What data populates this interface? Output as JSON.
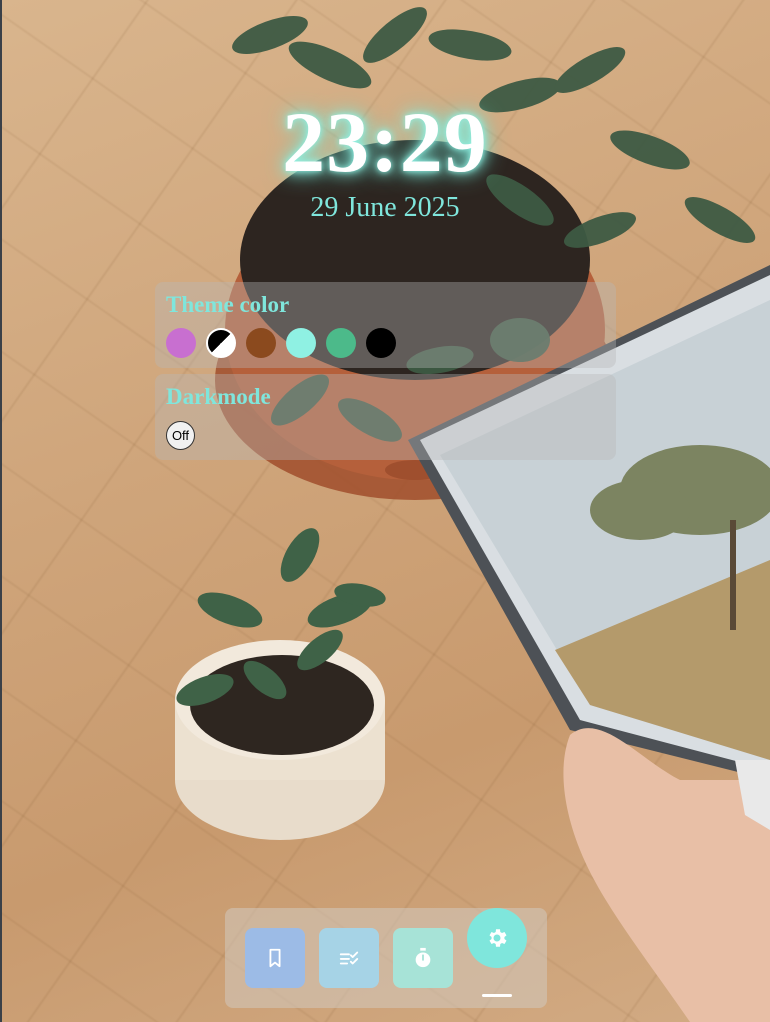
{
  "clock": {
    "time": "23:29",
    "date": "29 June 2025"
  },
  "settings": {
    "theme_title": "Theme color",
    "theme_colors": [
      {
        "name": "orchid",
        "color": "#c86fd0"
      },
      {
        "name": "mono",
        "color": "#000000"
      },
      {
        "name": "brown",
        "color": "#8b4a1e"
      },
      {
        "name": "aqua",
        "color": "#8ff1e3"
      },
      {
        "name": "green",
        "color": "#4cba8a"
      },
      {
        "name": "black",
        "color": "#000000"
      }
    ],
    "darkmode_title": "Darkmode",
    "darkmode_state": "Off"
  },
  "dock": {
    "items": [
      {
        "icon": "bookmark-icon",
        "color": "#9cbbe6"
      },
      {
        "icon": "checklist-icon",
        "color": "#a6d3e6"
      },
      {
        "icon": "stopwatch-icon",
        "color": "#a7e3d7"
      },
      {
        "icon": "gear-icon",
        "color": "#7fe6dc"
      }
    ]
  }
}
